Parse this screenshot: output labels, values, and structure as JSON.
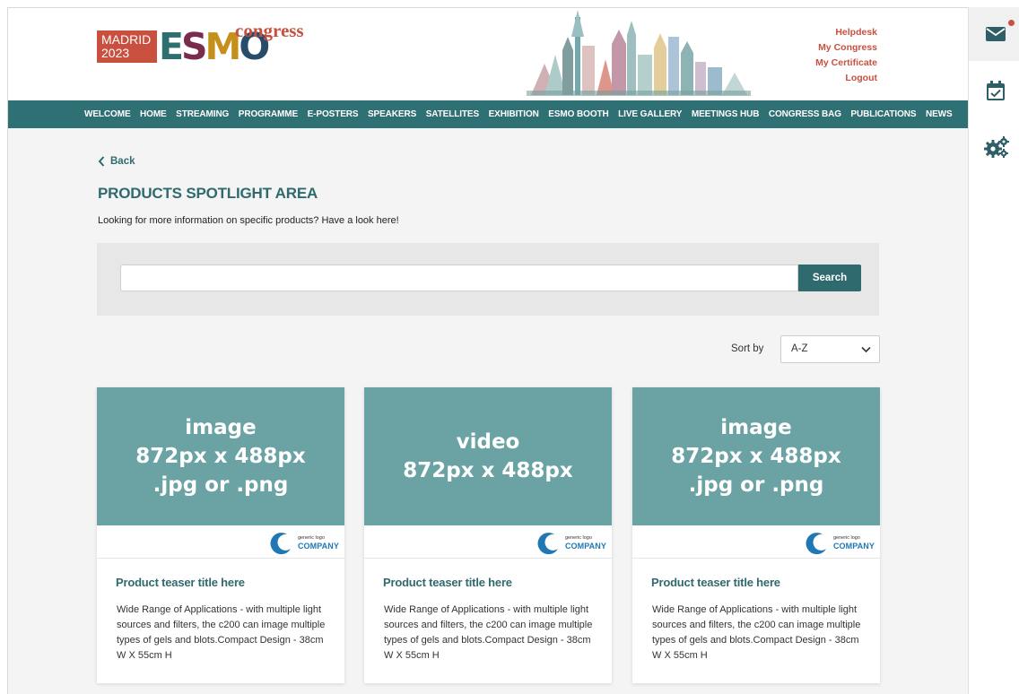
{
  "brand": {
    "city_year": "MADRID\n2023",
    "letters": [
      "E",
      "S",
      "M",
      "O"
    ],
    "suffix": "congress",
    "accent_color": "#c9503f",
    "nav_color": "#2f7074"
  },
  "utility_links": [
    "Helpdesk",
    "My Congress",
    "My Certificate",
    "Logout"
  ],
  "nav_items": [
    "WELCOME",
    "HOME",
    "STREAMING",
    "PROGRAMME",
    "E-POSTERS",
    "SPEAKERS",
    "SATELLITES",
    "EXHIBITION",
    "ESMO BOOTH",
    "LIVE GALLERY",
    "MEETINGS HUB",
    "CONGRESS BAG",
    "PUBLICATIONS",
    "NEWS"
  ],
  "page": {
    "back_label": "Back",
    "title": "PRODUCTS SPOTLIGHT AREA",
    "intro": "Looking for more information on specific products? Have a look here!"
  },
  "search": {
    "value": "",
    "placeholder": "",
    "button_label": "Search"
  },
  "sort": {
    "label": "Sort by",
    "selected": "A-Z"
  },
  "cards": [
    {
      "media_text": "image\n872px x 488px\n.jpg or .png",
      "logo_small": "generic logo",
      "logo_big": "COMPANY",
      "title": "Product teaser title here",
      "description": "Wide Range of Applications - with multiple light sources and filters, the c200 can image multiple types of gels and blots.Compact Design - 38cm W X 55cm H"
    },
    {
      "media_text": "video\n872px x 488px",
      "logo_small": "generic logo",
      "logo_big": "COMPANY",
      "title": "Product teaser title here",
      "description": "Wide Range of Applications - with multiple light sources and filters, the c200 can image multiple types of gels and blots.Compact Design - 38cm W X 55cm H"
    },
    {
      "media_text": "image\n872px x 488px\n.jpg or .png",
      "logo_small": "generic logo",
      "logo_big": "COMPANY",
      "title": "Product teaser title here",
      "description": "Wide Range of Applications - with multiple light sources and filters, the c200 can image multiple types of gels and blots.Compact Design - 38cm W X 55cm H"
    }
  ],
  "rail_icons": [
    "envelope-icon",
    "calendar-check-icon",
    "gears-icon"
  ]
}
